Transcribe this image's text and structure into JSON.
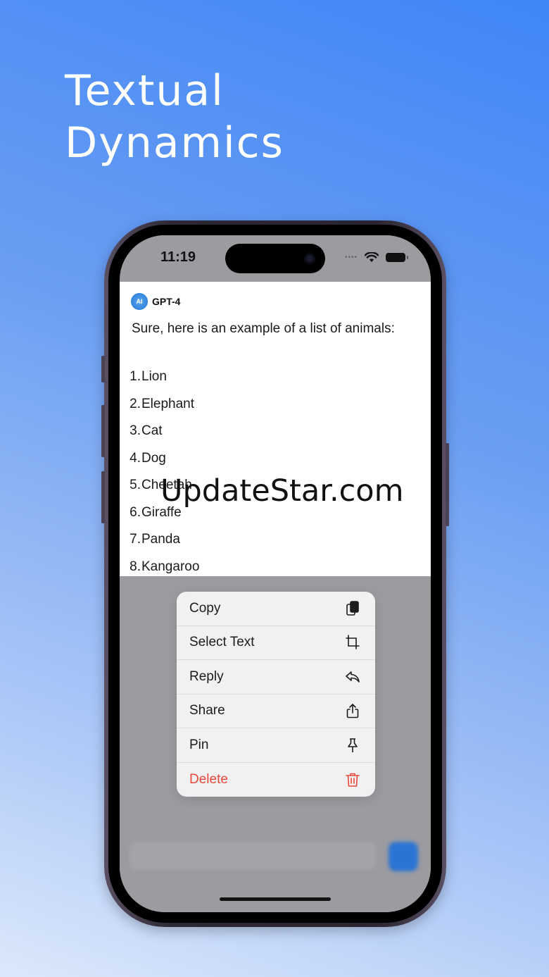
{
  "headline": [
    "Textual",
    "Dynamics"
  ],
  "status_bar": {
    "time": "11:19"
  },
  "chat": {
    "sender": "GPT-4",
    "avatar_text": "AI",
    "message": "Sure, here is an example of a list of animals:",
    "list": [
      {
        "num": "1.",
        "text": "Lion"
      },
      {
        "num": "2.",
        "text": "Elephant"
      },
      {
        "num": "3.",
        "text": "Cat"
      },
      {
        "num": "4.",
        "text": "Dog"
      },
      {
        "num": "5.",
        "text": "Cheetah"
      },
      {
        "num": "6.",
        "text": "Giraffe"
      },
      {
        "num": "7.",
        "text": "Panda"
      },
      {
        "num": "8.",
        "text": "Kangaroo"
      }
    ]
  },
  "context_menu": [
    {
      "label": "Copy",
      "icon": "copy-icon"
    },
    {
      "label": "Select Text",
      "icon": "crop-icon"
    },
    {
      "label": "Reply",
      "icon": "reply-icon"
    },
    {
      "label": "Share",
      "icon": "share-icon"
    },
    {
      "label": "Pin",
      "icon": "pin-icon"
    },
    {
      "label": "Delete",
      "icon": "trash-icon",
      "color": "#e8473a"
    }
  ],
  "watermark": "UpdateStar.com"
}
